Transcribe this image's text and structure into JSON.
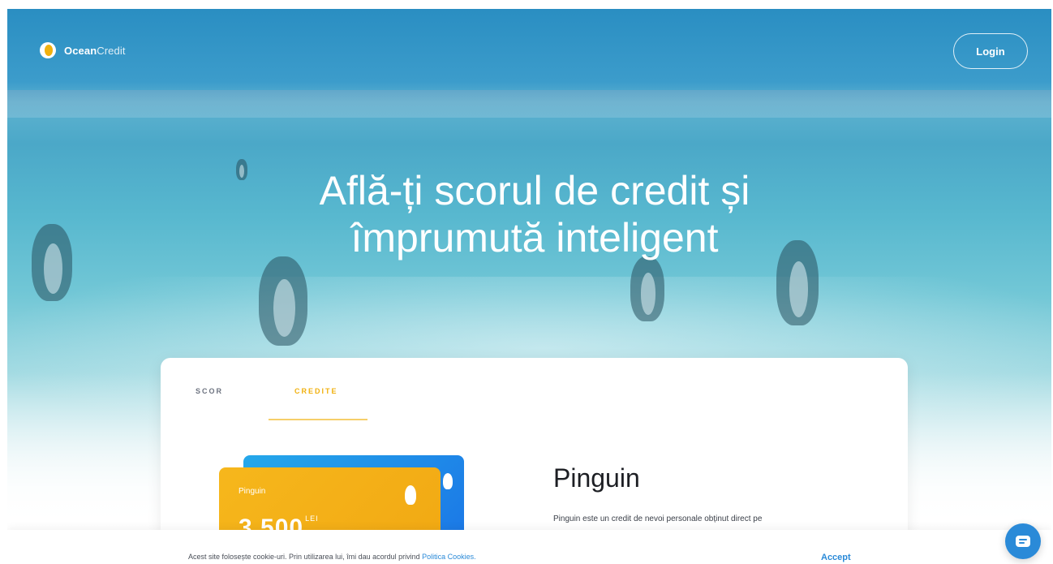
{
  "brand": {
    "name_bold": "Ocean",
    "name_light": "Credit"
  },
  "header": {
    "login_label": "Login"
  },
  "hero": {
    "headline_line1": "Află-ți scorul de credit și",
    "headline_line2": "împrumută inteligent"
  },
  "card": {
    "tabs": [
      {
        "label": "SCOR"
      },
      {
        "label": "CREDITE"
      }
    ],
    "active_tab": "CREDITE",
    "product_card": {
      "name": "Pinguin",
      "amount": "3.500",
      "currency": "LEI"
    },
    "product_title": "Pinguin",
    "product_description": "Pinguin este un credit de nevoi personale obținut direct pe"
  },
  "cookie_bar": {
    "text": "Acest site folosește cookie-uri. Prin utilizarea lui, îmi dau acordul privind ",
    "link_label": "Politica Cookies.",
    "accept_label": "Accept"
  },
  "colors": {
    "accent_yellow": "#f1b10f",
    "accent_blue": "#2a8ad8",
    "hero_blue": "#3c9ccb"
  },
  "icons": {
    "logo": "ocean-logo-icon",
    "chat": "chat-icon",
    "penguin": "penguin-icon"
  }
}
